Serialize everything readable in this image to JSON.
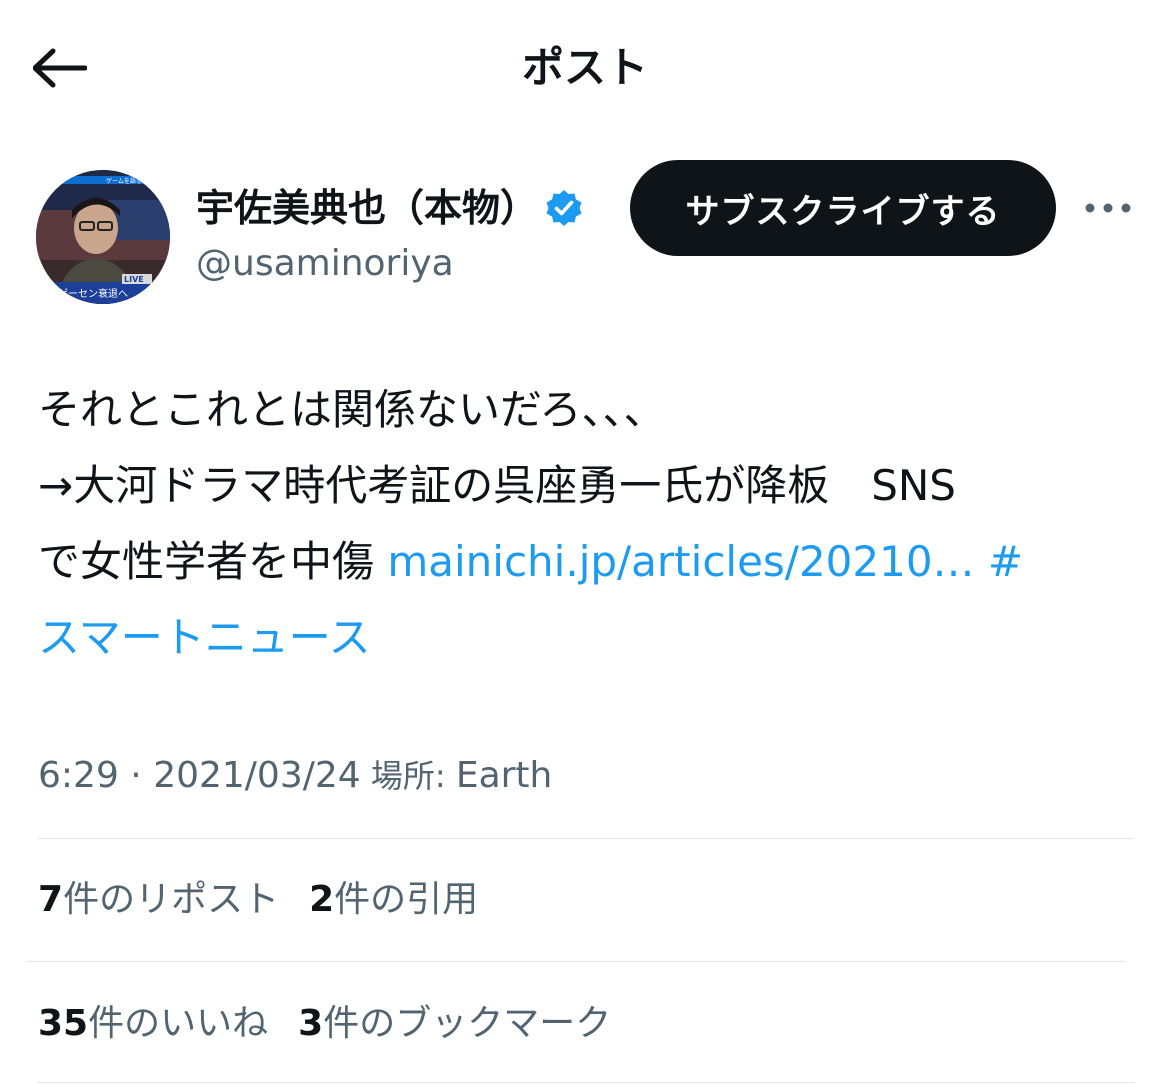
{
  "header": {
    "title": "ポスト"
  },
  "author": {
    "display_name": "宇佐美典也（本物）",
    "handle": "@usaminoriya",
    "verified": true,
    "avatar_caption_top": "ゲームを語る",
    "avatar_badge": "LIVE",
    "avatar_caption_bottom": "ゲーセン衰退へ"
  },
  "actions": {
    "subscribe_label": "サブスクライブする"
  },
  "post": {
    "line1": "それとこれとは関係ないだろ、、、",
    "line2": "→大河ドラマ時代考証の呉座勇一氏が降板　SNS",
    "line3_text": "で女性学者を中傷 ",
    "link_text": "mainichi.jp/articles/20210…",
    "hashtag_hash": " #",
    "hashtag_text": "スマートニュース"
  },
  "meta": {
    "time": "6:29",
    "separator": " · ",
    "date": "2021/03/24",
    "location_label": " 場所: ",
    "location": "Earth"
  },
  "stats": {
    "reposts_count": "7",
    "reposts_label": "件のリポスト",
    "quotes_count": "2",
    "quotes_label": "件の引用",
    "likes_count": "35",
    "likes_label": "件のいいね",
    "bookmarks_count": "3",
    "bookmarks_label": "件のブックマーク"
  },
  "colors": {
    "link": "#1d9bf0",
    "text": "#0f1419",
    "secondary": "#536471",
    "verified": "#1d9bf0"
  }
}
